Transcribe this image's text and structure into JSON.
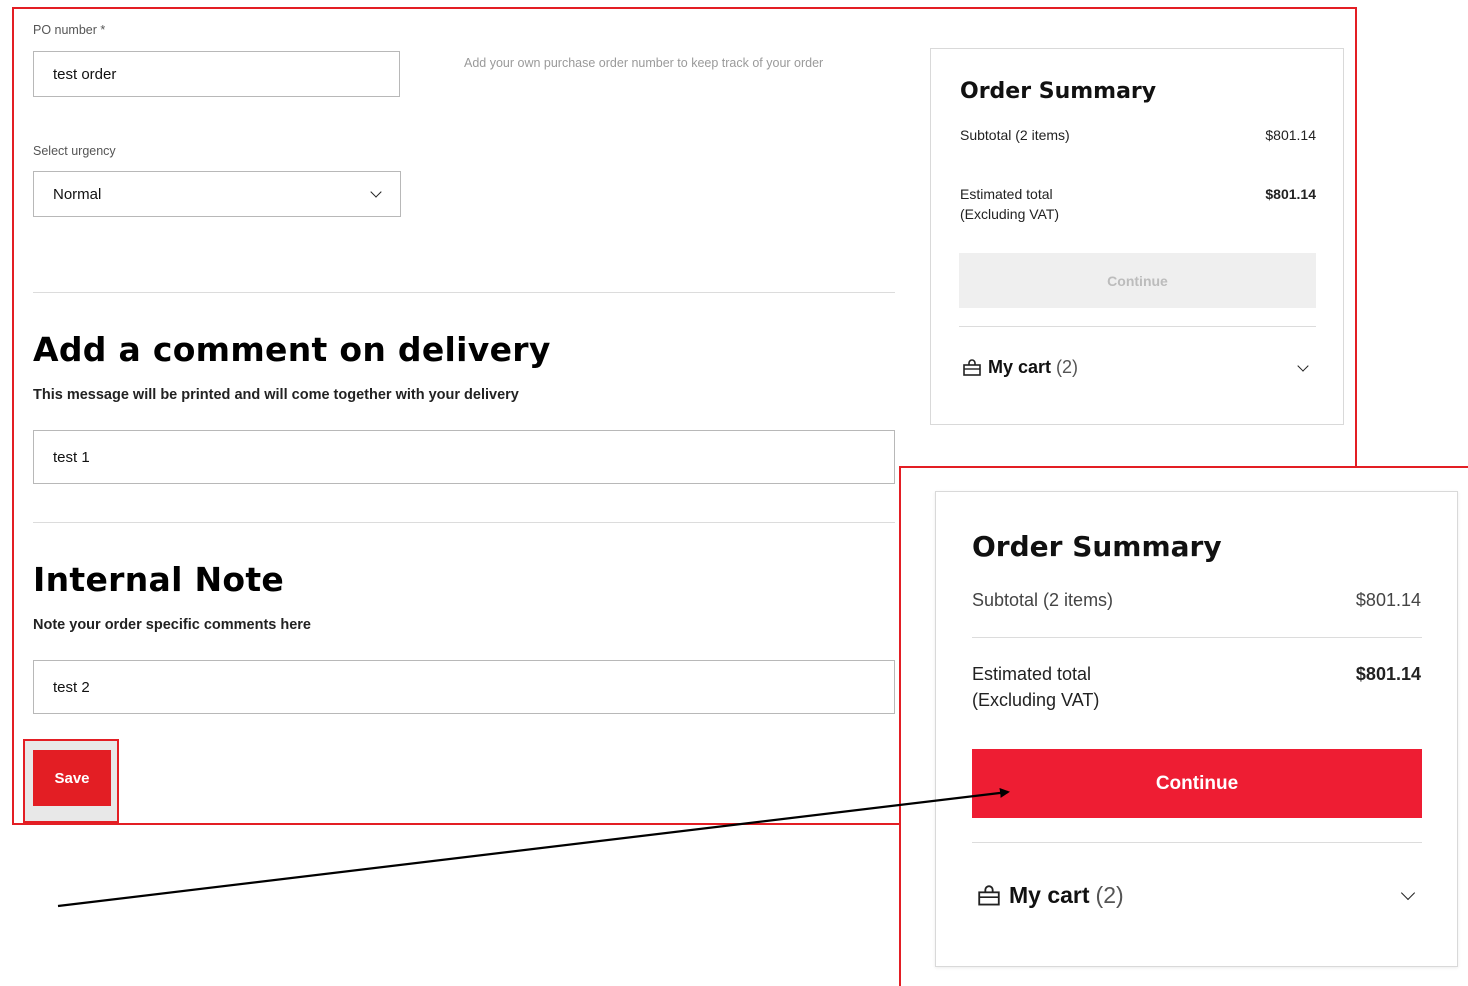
{
  "form": {
    "po_label": "PO number",
    "po_required": "*",
    "po_value": "test order",
    "po_hint": "Add your own purchase order number to keep track of your order",
    "urgency_label": "Select urgency",
    "urgency_value": "Normal"
  },
  "delivery_comment": {
    "title": "Add a comment on delivery",
    "subtitle": "This message will be printed and will come together with your delivery",
    "value": "test 1"
  },
  "internal_note": {
    "title": "Internal Note",
    "subtitle": "Note your order specific comments here",
    "value": "test 2"
  },
  "save_label": "Save",
  "order_summary": {
    "title": "Order Summary",
    "subtotal_label": "Subtotal (2 items)",
    "subtotal_value": "$801.14",
    "total_label": "Estimated total",
    "total_sublabel": "(Excluding VAT)",
    "total_value": "$801.14",
    "continue_label": "Continue",
    "cart_label": "My cart",
    "cart_count": "(2)"
  },
  "icons": {
    "cart": "shopping-bag-icon",
    "expand": "chevron-down-icon"
  },
  "colors": {
    "accent": "#e31e24",
    "continue_enabled": "#ee1d33",
    "continue_disabled": "#efefef"
  }
}
